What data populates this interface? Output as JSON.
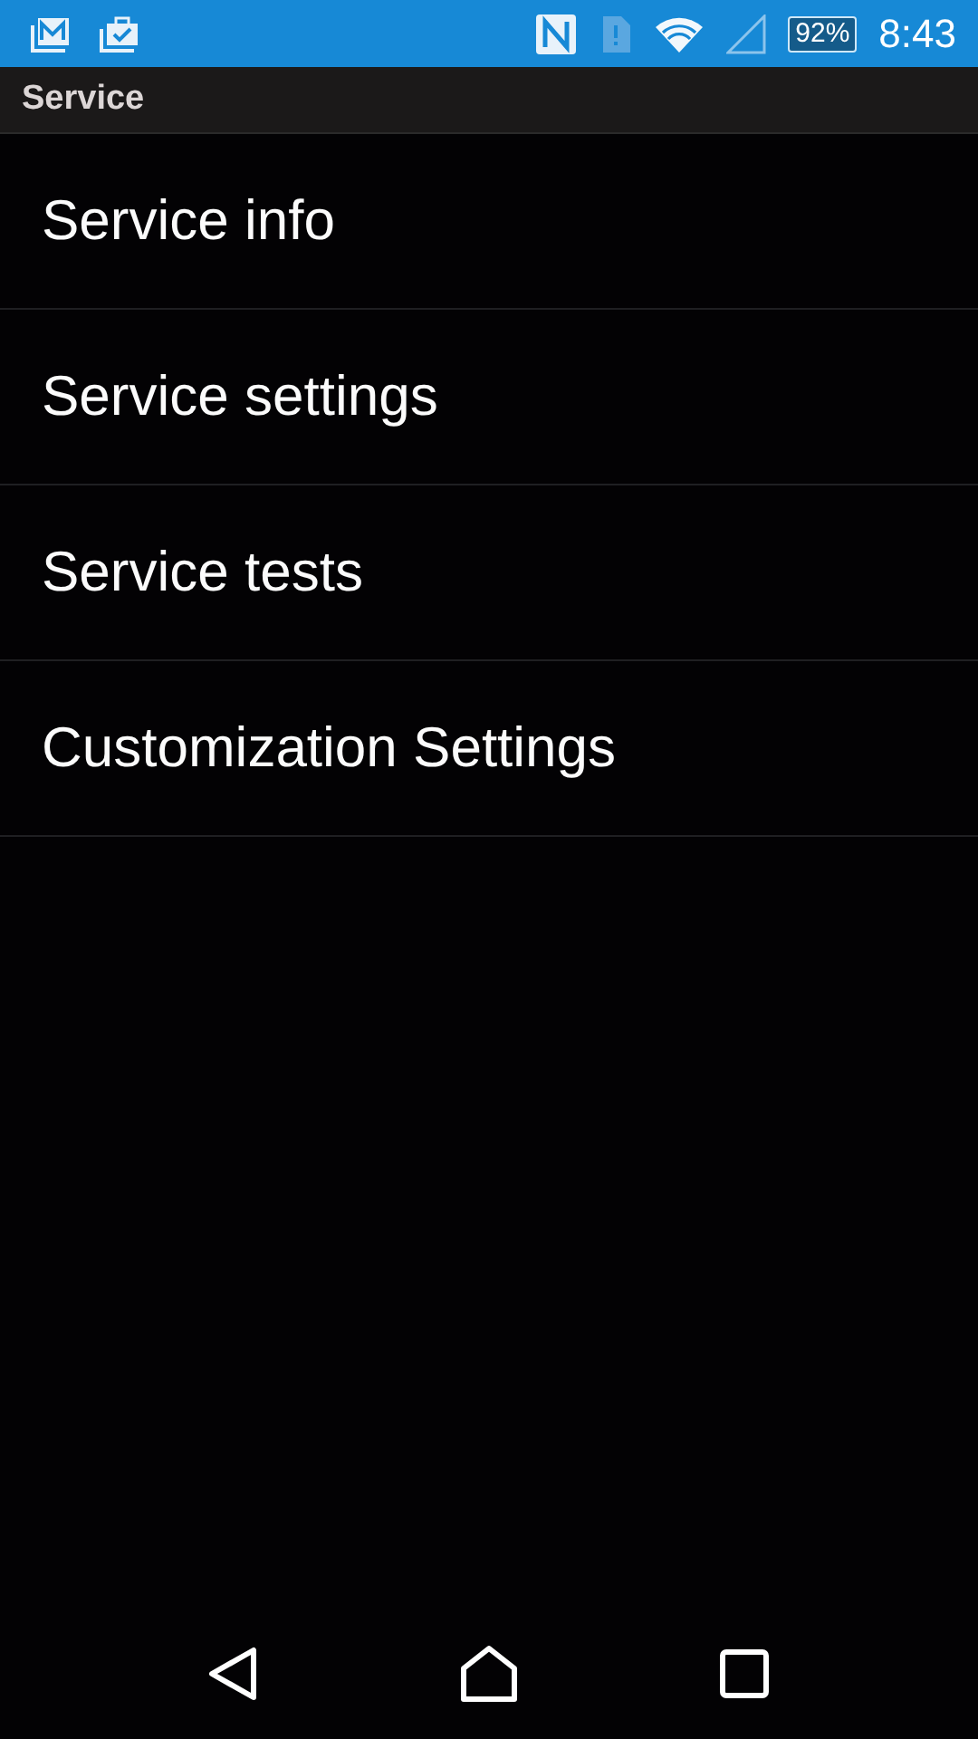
{
  "status_bar": {
    "battery": "92%",
    "time": "8:43"
  },
  "title": "Service",
  "items": [
    {
      "label": "Service info"
    },
    {
      "label": "Service settings"
    },
    {
      "label": "Service tests"
    },
    {
      "label": "Customization Settings"
    }
  ]
}
